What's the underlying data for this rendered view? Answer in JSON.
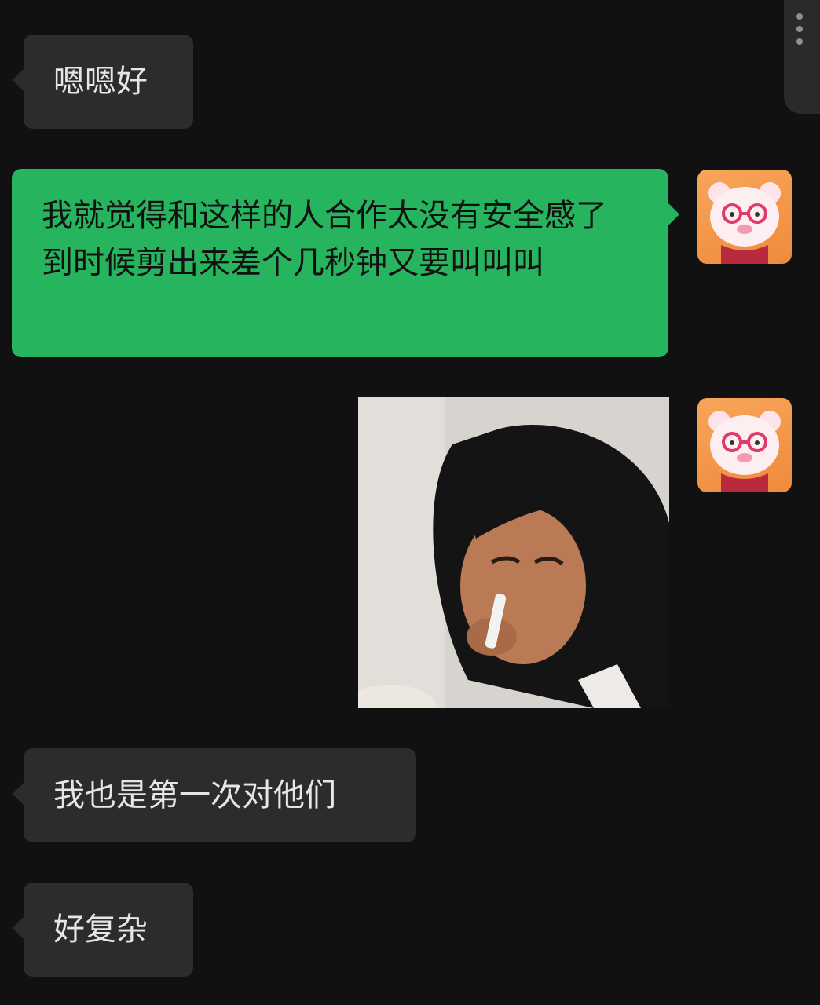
{
  "messages": [
    {
      "side": "in",
      "type": "text",
      "text": "嗯嗯好"
    },
    {
      "side": "out",
      "type": "text",
      "text": "我就觉得和这样的人合作太没有安全感了 到时候剪出来差个几秒钟又要叫叫叫"
    },
    {
      "side": "out",
      "type": "image",
      "image_desc": "sticker"
    },
    {
      "side": "in",
      "type": "text",
      "text": "我也是第一次对他们"
    },
    {
      "side": "in",
      "type": "text",
      "text": "好复杂"
    }
  ],
  "colors": {
    "background": "#111111",
    "incoming_bubble": "#2c2c2c",
    "outgoing_bubble": "#27b45f",
    "avatar_bg": "#f08a3c"
  },
  "icons": {
    "more_menu": "more-vertical-icon",
    "avatar": "bear-with-glasses-avatar-icon"
  }
}
